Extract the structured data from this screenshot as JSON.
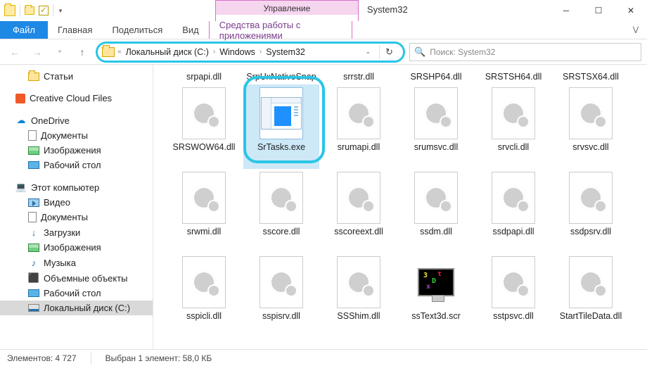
{
  "window": {
    "manage_tab": "Управление",
    "title": "System32",
    "tools_label": "Средства работы с приложениями"
  },
  "ribbon": {
    "file": "Файл",
    "tabs": [
      "Главная",
      "Поделиться",
      "Вид"
    ]
  },
  "address": {
    "crumbs": [
      "Локальный диск (C:)",
      "Windows",
      "System32"
    ]
  },
  "search": {
    "placeholder": "Поиск: System32"
  },
  "tree": {
    "items": [
      {
        "icon": "folder",
        "label": "Статьи",
        "depth": 1
      },
      {
        "icon": "cc",
        "label": "Creative Cloud Files",
        "depth": 0,
        "gap": true
      },
      {
        "icon": "od",
        "label": "OneDrive",
        "depth": 0,
        "gap": true
      },
      {
        "icon": "doc",
        "label": "Документы",
        "depth": 1
      },
      {
        "icon": "img",
        "label": "Изображения",
        "depth": 1
      },
      {
        "icon": "desk",
        "label": "Рабочий стол",
        "depth": 1
      },
      {
        "icon": "pc",
        "label": "Этот компьютер",
        "depth": 0,
        "gap": true
      },
      {
        "icon": "vid",
        "label": "Видео",
        "depth": 1
      },
      {
        "icon": "doc",
        "label": "Документы",
        "depth": 1
      },
      {
        "icon": "dl",
        "label": "Загрузки",
        "depth": 1
      },
      {
        "icon": "img",
        "label": "Изображения",
        "depth": 1
      },
      {
        "icon": "mus",
        "label": "Музыка",
        "depth": 1
      },
      {
        "icon": "cube",
        "label": "Объемные объекты",
        "depth": 1
      },
      {
        "icon": "desk",
        "label": "Рабочий стол",
        "depth": 1
      },
      {
        "icon": "disk",
        "label": "Локальный диск (C:)",
        "depth": 1,
        "selected": true
      }
    ]
  },
  "files": {
    "row0": [
      "srpapi.dll",
      "SrpUxNativeSnap",
      "srrstr.dll",
      "SRSHP64.dll",
      "SRSTSH64.dll",
      "SRSTSX64.dll"
    ],
    "rows": [
      [
        {
          "name": "SRSWOW64.dll",
          "type": "dll"
        },
        {
          "name": "SrTasks.exe",
          "type": "exe",
          "selected": true
        },
        {
          "name": "srumapi.dll",
          "type": "dll"
        },
        {
          "name": "srumsvc.dll",
          "type": "dll"
        },
        {
          "name": "srvcli.dll",
          "type": "dll"
        },
        {
          "name": "srvsvc.dll",
          "type": "dll"
        }
      ],
      [
        {
          "name": "srwmi.dll",
          "type": "dll"
        },
        {
          "name": "sscore.dll",
          "type": "dll"
        },
        {
          "name": "sscoreext.dll",
          "type": "dll"
        },
        {
          "name": "ssdm.dll",
          "type": "dll"
        },
        {
          "name": "ssdpapi.dll",
          "type": "dll"
        },
        {
          "name": "ssdpsrv.dll",
          "type": "dll"
        }
      ],
      [
        {
          "name": "sspicli.dll",
          "type": "dll"
        },
        {
          "name": "sspisrv.dll",
          "type": "dll"
        },
        {
          "name": "SSShim.dll",
          "type": "dll"
        },
        {
          "name": "ssText3d.scr",
          "type": "scr"
        },
        {
          "name": "sstpsvc.dll",
          "type": "dll"
        },
        {
          "name": "StartTileData.dll",
          "type": "dll"
        }
      ]
    ]
  },
  "status": {
    "count_label": "Элементов:",
    "count": "4 727",
    "sel_label": "Выбран 1 элемент:",
    "sel_size": "58,0 КБ"
  }
}
